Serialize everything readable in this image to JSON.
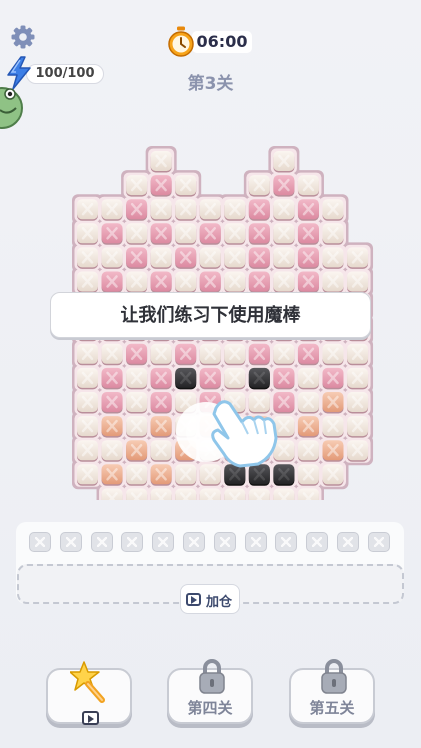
{
  "header": {
    "energy_label": "100/100",
    "timer_label": "06:00",
    "level_title": "第3关"
  },
  "tutorial": {
    "banner_text": "让我们练习下使用魔棒"
  },
  "tray": {
    "slot_count": 12,
    "add_stash_label": "加仓"
  },
  "bottom_bar": {
    "level4_label": "第四关",
    "level5_label": "第五关"
  },
  "icons": {
    "settings": "gear-icon",
    "energy": "lightning-icon",
    "timer": "stopwatch-icon",
    "wand": "magic-wand-icon",
    "lock": "lock-icon",
    "video": "video-ad-icon"
  },
  "colors": {
    "accent_text": "#8b93ad",
    "board_frame": "#c9a6b4",
    "tile_pink": "#e8a3b6",
    "tile_cream": "#f4ebe3",
    "tile_peach": "#efb89b",
    "tile_black": "#3b3b3e"
  },
  "board": {
    "rows": [
      "..........c...........c....",
      "..........................."
    ]
  }
}
